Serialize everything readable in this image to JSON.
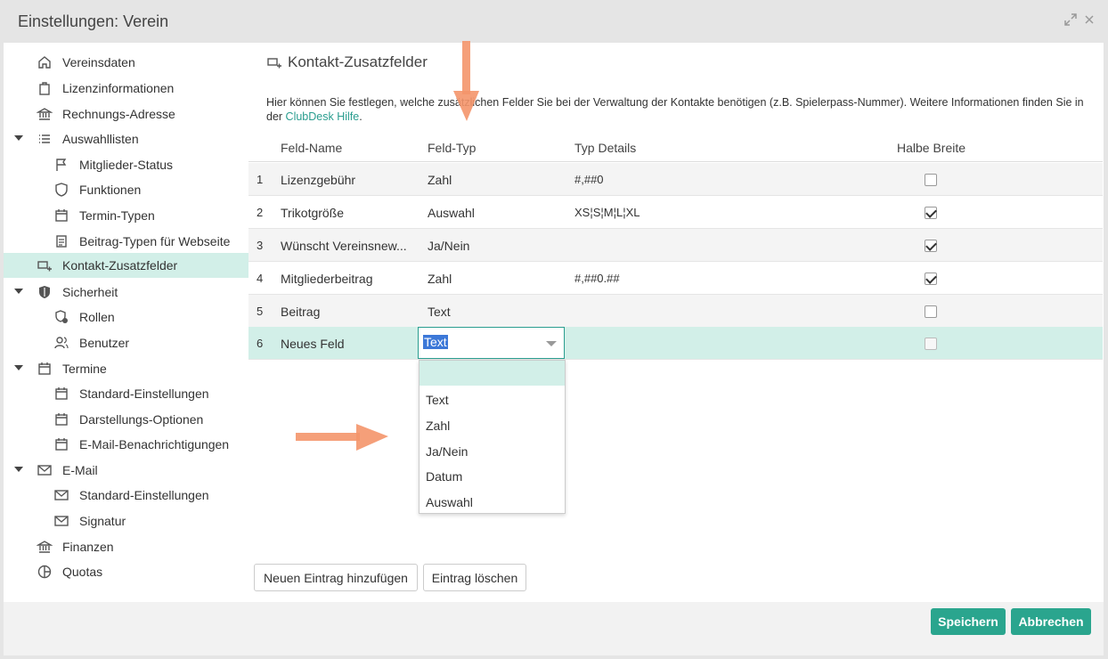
{
  "window": {
    "title": "Einstellungen: Verein"
  },
  "sidebar": {
    "items": [
      {
        "label": "Vereinsdaten"
      },
      {
        "label": "Lizenzinformationen"
      },
      {
        "label": "Rechnungs-Adresse"
      },
      {
        "label": "Auswahllisten"
      },
      {
        "label": "Mitglieder-Status"
      },
      {
        "label": "Funktionen"
      },
      {
        "label": "Termin-Typen"
      },
      {
        "label": "Beitrag-Typen für Webseite"
      },
      {
        "label": "Kontakt-Zusatzfelder"
      },
      {
        "label": "Sicherheit"
      },
      {
        "label": "Rollen"
      },
      {
        "label": "Benutzer"
      },
      {
        "label": "Termine"
      },
      {
        "label": "Standard-Einstellungen"
      },
      {
        "label": "Darstellungs-Optionen"
      },
      {
        "label": "E-Mail-Benachrichtigungen"
      },
      {
        "label": "E-Mail"
      },
      {
        "label": "Standard-Einstellungen"
      },
      {
        "label": "Signatur"
      },
      {
        "label": "Finanzen"
      },
      {
        "label": "Quotas"
      }
    ]
  },
  "panel": {
    "title": "Kontakt-Zusatzfelder",
    "description_prefix": "Hier können Sie festlegen, welche zusätzlichen Felder Sie bei der Verwaltung der Kontakte benötigen (z.B. Spielerpass-Nummer). Weitere Informationen finden Sie in der ",
    "description_link": "ClubDesk Hilfe",
    "description_suffix": "."
  },
  "table": {
    "headers": {
      "name": "Feld-Name",
      "type": "Feld-Typ",
      "details": "Typ Details",
      "half_width": "Halbe Breite"
    },
    "rows": [
      {
        "num": "1",
        "name": "Lizenzgebühr",
        "type": "Zahl",
        "details": "#,##0",
        "half_width": false
      },
      {
        "num": "2",
        "name": "Trikotgröße",
        "type": "Auswahl",
        "details": "XS¦S¦M¦L¦XL",
        "half_width": true
      },
      {
        "num": "3",
        "name": "Wünscht Vereinsnew...",
        "type": "Ja/Nein",
        "details": "",
        "half_width": true
      },
      {
        "num": "4",
        "name": "Mitgliederbeitrag",
        "type": "Zahl",
        "details": "#,##0.##",
        "half_width": true
      },
      {
        "num": "5",
        "name": "Beitrag",
        "type": "Text",
        "details": "",
        "half_width": false
      },
      {
        "num": "6",
        "name": "Neues Feld",
        "type": "Text",
        "details": "",
        "half_width": false
      }
    ]
  },
  "type_select": {
    "value": "Text",
    "options": [
      "",
      "Text",
      "Zahl",
      "Ja/Nein",
      "Datum",
      "Auswahl"
    ]
  },
  "buttons": {
    "add": "Neuen Eintrag hinzufügen",
    "delete": "Eintrag löschen",
    "save": "Speichern",
    "cancel": "Abbrechen"
  },
  "colors": {
    "accent": "#2aa58e",
    "selection": "#d2efe8",
    "annotation_arrow": "#f4956a"
  }
}
